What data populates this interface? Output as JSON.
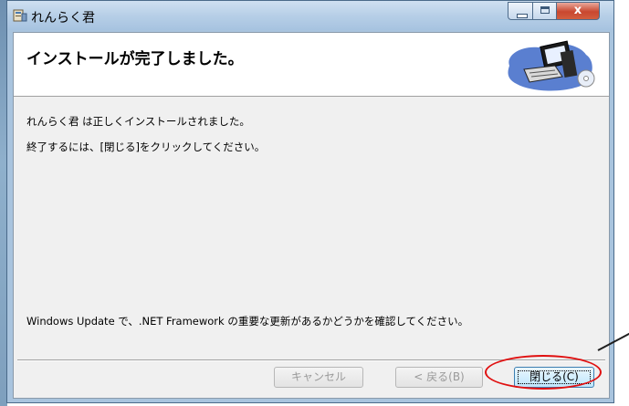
{
  "window": {
    "title": "れんらく君",
    "minimize_label": "",
    "maximize_label": "",
    "close_label": "x"
  },
  "header": {
    "title": "インストールが完了しました。",
    "icon": "computer-install-icon"
  },
  "body": {
    "line1": "れんらく君 は正しくインストールされました。",
    "line2": "終了するには、[閉じる]をクリックしてください。",
    "line3": "Windows Update で、.NET Framework の重要な更新があるかどうかを確認してください。"
  },
  "buttons": {
    "cancel": "キャンセル",
    "back": "< 戻る(B)",
    "close": "閉じる(C)"
  },
  "annotation": {
    "highlight_color": "#e01010"
  }
}
